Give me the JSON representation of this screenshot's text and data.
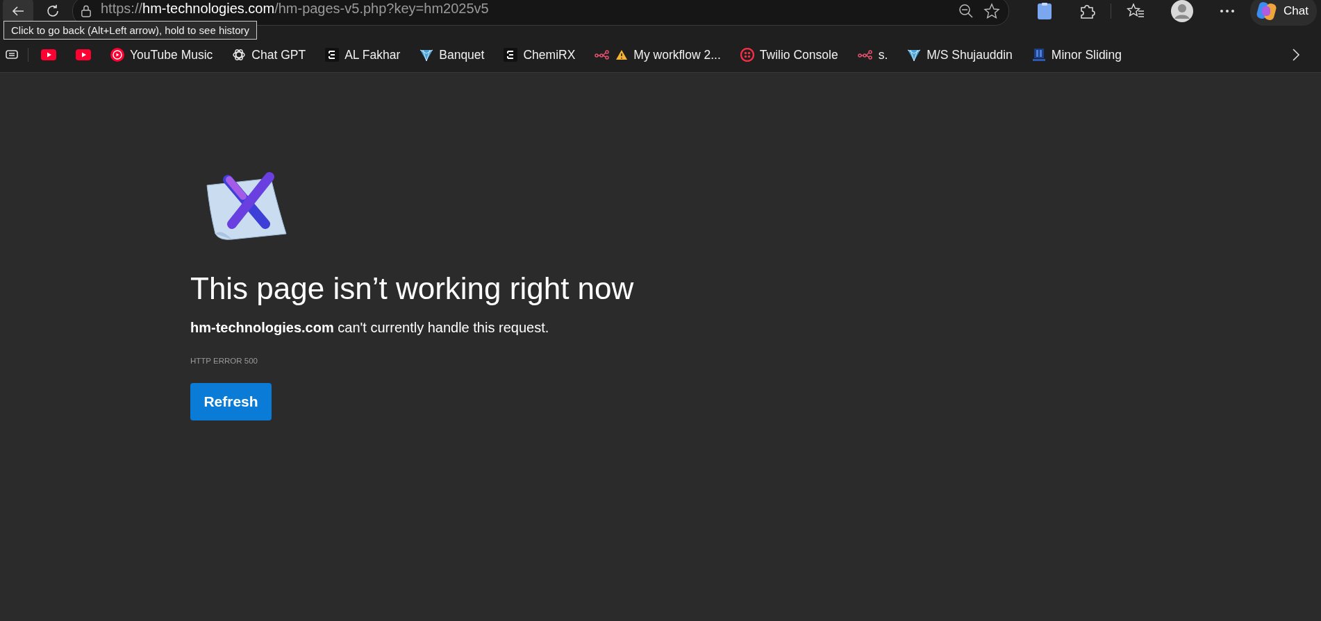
{
  "toolbar": {
    "address_bar": {
      "scheme": "https://",
      "host": "hm-technologies.com",
      "path": "/hm-pages-v5.php?key=hm2025v5"
    },
    "tooltip": "Click to go back (Alt+Left arrow), hold to see history",
    "chat_button": "Chat"
  },
  "bookmarks": [
    {
      "kind": "youtube"
    },
    {
      "kind": "youtube"
    },
    {
      "kind": "ytmusic",
      "label": "YouTube Music"
    },
    {
      "kind": "openai",
      "label": "Chat GPT"
    },
    {
      "kind": "e-logo",
      "label": "AL Fakhar"
    },
    {
      "kind": "diamond",
      "label": "Banquet"
    },
    {
      "kind": "e-logo",
      "label": "ChemiRX"
    },
    {
      "kind": "nodes",
      "warning": true,
      "label": "My workflow 2..."
    },
    {
      "kind": "twilio",
      "label": "Twilio Console"
    },
    {
      "kind": "nodes",
      "warning": false,
      "label": "s."
    },
    {
      "kind": "diamond",
      "label": "M/S Shujauddin"
    },
    {
      "kind": "building",
      "label": "Minor Sliding"
    }
  ],
  "error_page": {
    "heading": "This page isn’t working right now",
    "message": "**hm-technologies.com** can't currently handle this request.",
    "error_code": "HTTP ERROR 500",
    "button": "Refresh"
  }
}
